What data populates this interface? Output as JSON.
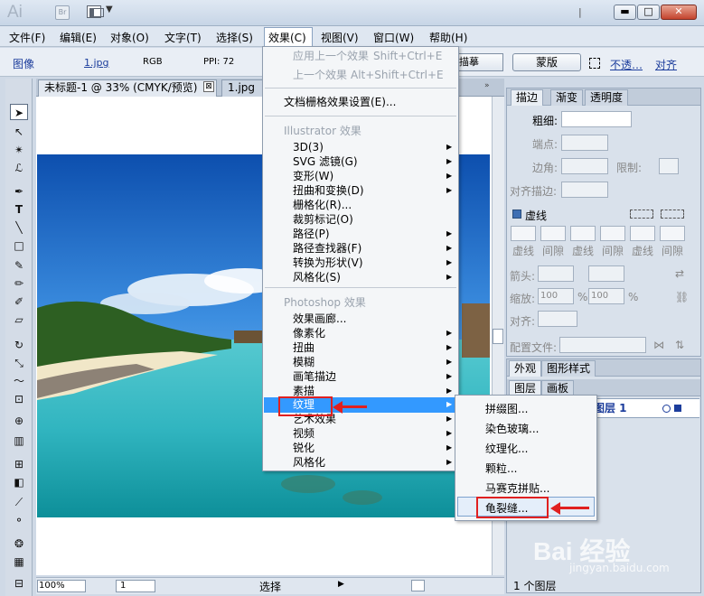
{
  "titlebar": {
    "logo": "Ai",
    "bridge": "Br",
    "min": "▬",
    "max": "□",
    "close": "✕"
  },
  "menubar": [
    "文件(F)",
    "编辑(E)",
    "对象(O)",
    "文字(T)",
    "选择(S)",
    "效果(C)",
    "视图(V)",
    "窗口(W)",
    "帮助(H)"
  ],
  "control_bar": {
    "image_label": "图像",
    "file_link": "1.jpg",
    "color_mode": "RGB",
    "ppi": "PPI: 72",
    "trace_button": "描摹",
    "mask_button": "蒙版",
    "opacity_link": "不透…",
    "align_link": "对齐"
  },
  "doc_tabs": [
    {
      "label": "未标题-1 @ 33% (CMYK/预览)",
      "close": "⊠"
    },
    {
      "label": "1.jpg @"
    }
  ],
  "effect_menu": {
    "recent": [
      {
        "label": "应用上一个效果",
        "shortcut": "Shift+Ctrl+E"
      },
      {
        "label": "上一个效果",
        "shortcut": "Alt+Shift+Ctrl+E"
      }
    ],
    "doc_raster": "文档栅格效果设置(E)...",
    "illustrator_header": "Illustrator 效果",
    "illustrator_items": [
      "3D(3)",
      "SVG 滤镜(G)",
      "变形(W)",
      "扭曲和变换(D)",
      "栅格化(R)...",
      "裁剪标记(O)",
      "路径(P)",
      "路径查找器(F)",
      "转换为形状(V)",
      "风格化(S)"
    ],
    "photoshop_header": "Photoshop 效果",
    "photoshop_items": [
      "效果画廊...",
      "像素化",
      "扭曲",
      "模糊",
      "画笔描边",
      "素描",
      "纹理",
      "艺术效果",
      "视频",
      "锐化",
      "风格化"
    ]
  },
  "texture_submenu": [
    "拼缀图...",
    "染色玻璃...",
    "纹理化...",
    "颗粒...",
    "马赛克拼贴...",
    "龟裂缝..."
  ],
  "stroke_panel": {
    "tabs": [
      "描边",
      "渐变",
      "透明度"
    ],
    "weight_label": "粗细:",
    "cap_label": "端点:",
    "corner_label": "边角:",
    "limit_label": "限制:",
    "align_label": "对齐描边:",
    "dashed_label": "虚线",
    "dash_labels": [
      "虚线",
      "间隙",
      "虚线",
      "间隙",
      "虚线",
      "间隙"
    ],
    "arrow_label": "箭头:",
    "scale_label": "缩放:",
    "scale_values": [
      "100",
      "100"
    ],
    "percent": "%",
    "align2_label": "对齐:",
    "profile_label": "配置文件:"
  },
  "layers_panel": {
    "tabs_top": [
      "外观",
      "图形样式"
    ],
    "tabs": [
      "图层",
      "画板"
    ],
    "layer_name": "图层 1",
    "layer_count": "1 个图层"
  },
  "status_bar": {
    "zoom": "100%",
    "page": "1",
    "tool": "选择"
  },
  "watermark": {
    "brand": "Bai 经验",
    "url": "jingyan.baidu.com"
  }
}
